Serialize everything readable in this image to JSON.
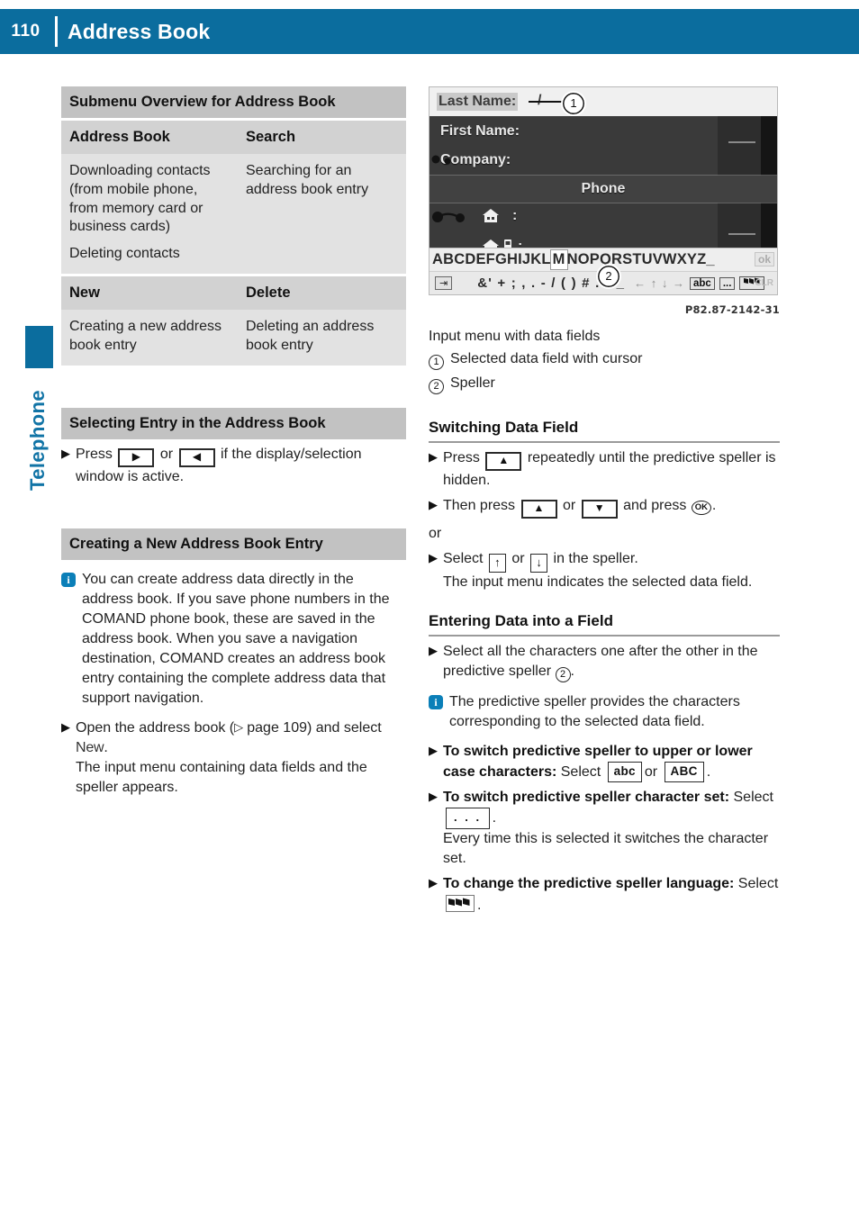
{
  "header": {
    "page_number": "110",
    "title": "Address Book",
    "side_tab_label": "Telephone"
  },
  "left_column": {
    "table": {
      "title": "Submenu Overview for Address Book",
      "groups": [
        {
          "headers": [
            "Address Book",
            "Search"
          ],
          "cells": [
            [
              "Downloading contacts (from mobile phone, from memory card or business cards)",
              "Deleting contacts"
            ],
            [
              "Searching for an address book entry"
            ]
          ]
        },
        {
          "headers": [
            "New",
            "Delete"
          ],
          "cells": [
            [
              "Creating a new address book entry"
            ],
            [
              "Deleting an address book entry"
            ]
          ]
        }
      ]
    },
    "selecting_entry": {
      "heading": "Selecting Entry in the Address Book",
      "step_pre": "Press",
      "step_or": "or",
      "step_post": "if the display/selection window is active.",
      "key_right": "right-arrow-key",
      "key_left": "left-arrow-key"
    },
    "creating_entry": {
      "heading": "Creating a New Address Book Entry",
      "info_text": "You can create address data directly in the address book. If you save phone numbers in the COMAND phone book, these are saved in the address book. When you save a navigation destination, COMAND creates an address book entry containing the complete address data that support navigation.",
      "step_pre": "Open the address book (",
      "step_ref": "page 109",
      "step_mid": ") and select ",
      "step_lcd": "New",
      "step_end": ".",
      "step_result": "The input menu containing data fields and the speller appears."
    }
  },
  "right_column": {
    "figure": {
      "lcd": {
        "field_last_name": "Last Name:",
        "cursor": "/",
        "field_first_name": "First Name:",
        "field_company": "Company:",
        "section_phone": "Phone",
        "colon": ":"
      },
      "speller": {
        "alphabet_before": "ABCDEFGHIJKL",
        "alphabet_highlight": "M",
        "alphabet_after": "NOPQRSTUVWXYZ_",
        "ok_key": "ok",
        "back_key": "⇥",
        "symbols": "&' + ; , . - / ( ) # . '",
        "underscore": "_",
        "nav_arrows": "← ↑ ↓ →",
        "abc_key": "abc",
        "dots_key": "...",
        "flag_key": "flags-icon",
        "clr_key": "CLR"
      },
      "callouts": {
        "one": "1",
        "two": "2"
      },
      "reference": "P82.87-2142-31",
      "caption": "Input menu with data fields",
      "legend": [
        {
          "num": "1",
          "text": "Selected data field with cursor"
        },
        {
          "num": "2",
          "text": "Speller"
        }
      ]
    },
    "switching_data_field": {
      "heading": "Switching Data Field",
      "step1_pre": "Press",
      "step1_post": "repeatedly until the predictive speller is hidden.",
      "step2_pre": "Then press",
      "step2_or": "or",
      "step2_mid": "and press",
      "step2_end": ".",
      "or_word": "or",
      "step3_pre": "Select",
      "step3_or": "or",
      "step3_post": "in the speller.",
      "step3_result": "The input menu indicates the selected data field.",
      "ok_label": "OK"
    },
    "entering_data": {
      "heading": "Entering Data into a Field",
      "step1_pre": "Select all the characters one after the other in the predictive speller ",
      "step1_ref": "2",
      "step1_end": ".",
      "info_text": "The predictive speller provides the characters corresponding to the selected data field.",
      "step2_bold": "To switch predictive speller to upper or lower case characters:",
      "step2_mid": " Select ",
      "step2_abc": "abc",
      "step2_or": "or",
      "step2_ABC": "ABC",
      "step2_end": ".",
      "step3_bold": "To switch predictive speller character set:",
      "step3_mid": " Select ",
      "step3_dots": ". . .",
      "step3_end": ".",
      "step3_result": "Every time this is selected it switches the character set.",
      "step4_bold": "To change the predictive speller language:",
      "step4_mid": " Select ",
      "step4_end": "."
    }
  },
  "colors": {
    "brand_blue": "#0b6d9e",
    "info_blue": "#0b7fb8",
    "table_title_bg": "#c2c2c2",
    "table_head_bg": "#d2d2d2",
    "table_body_bg": "#e2e2e2"
  }
}
